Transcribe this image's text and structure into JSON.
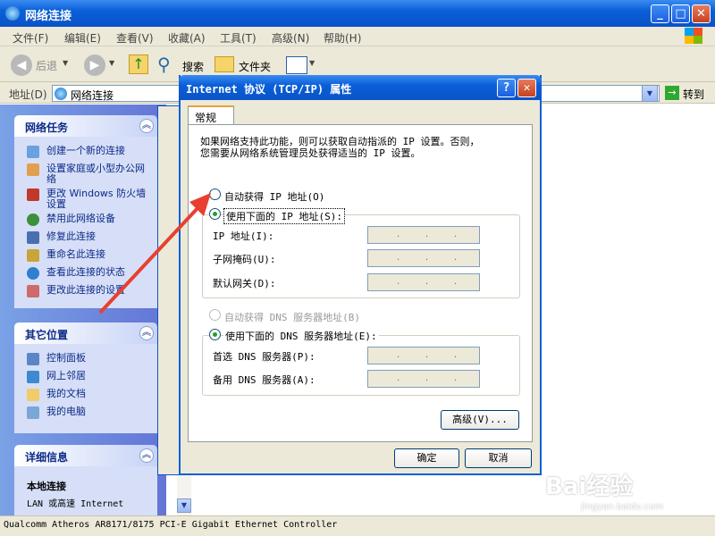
{
  "window": {
    "title": "网络连接"
  },
  "menu": [
    "文件(F)",
    "编辑(E)",
    "查看(V)",
    "收藏(A)",
    "工具(T)",
    "高级(N)",
    "帮助(H)"
  ],
  "toolbar": {
    "back": "后退",
    "search": "搜索",
    "folders": "文件夹"
  },
  "address": {
    "label": "地址(D)",
    "value": "网络连接",
    "go": "转到"
  },
  "left": {
    "network_tasks": {
      "title": "网络任务",
      "items": [
        "创建一个新的连接",
        "设置家庭或小型办公网络",
        "更改 Windows 防火墙设置",
        "禁用此网络设备",
        "修复此连接",
        "重命名此连接",
        "查看此连接的状态",
        "更改此连接的设置"
      ]
    },
    "other_places": {
      "title": "其它位置",
      "items": [
        "控制面板",
        "网上邻居",
        "我的文档",
        "我的电脑"
      ]
    },
    "details": {
      "title": "详细信息",
      "name": "本地连接",
      "desc": "LAN 或高速 Internet"
    }
  },
  "statusbar": {
    "text": "Qualcomm Atheros AR8171/8175 PCI-E Gigabit Ethernet Controller"
  },
  "dialog": {
    "title": "Internet 协议 (TCP/IP) 属性",
    "tab": "常规",
    "intro_line1": "如果网络支持此功能，则可以获取自动指派的 IP 设置。否则，",
    "intro_line2": "您需要从网络系统管理员处获得适当的 IP 设置。",
    "auto_ip": "自动获得 IP 地址(O)",
    "use_ip": "使用下面的 IP 地址(S):",
    "ip_label": "IP 地址(I):",
    "mask_label": "子网掩码(U):",
    "gateway_label": "默认网关(D):",
    "auto_dns": "自动获得 DNS 服务器地址(B)",
    "use_dns": "使用下面的 DNS 服务器地址(E):",
    "pref_dns": "首选 DNS 服务器(P):",
    "alt_dns": "备用 DNS 服务器(A):",
    "advanced": "高级(V)...",
    "ok": "确定",
    "cancel": "取消",
    "ip_dot": "."
  },
  "watermark": {
    "brand": "Bai经验",
    "url": "jingyan.baidu.com"
  }
}
